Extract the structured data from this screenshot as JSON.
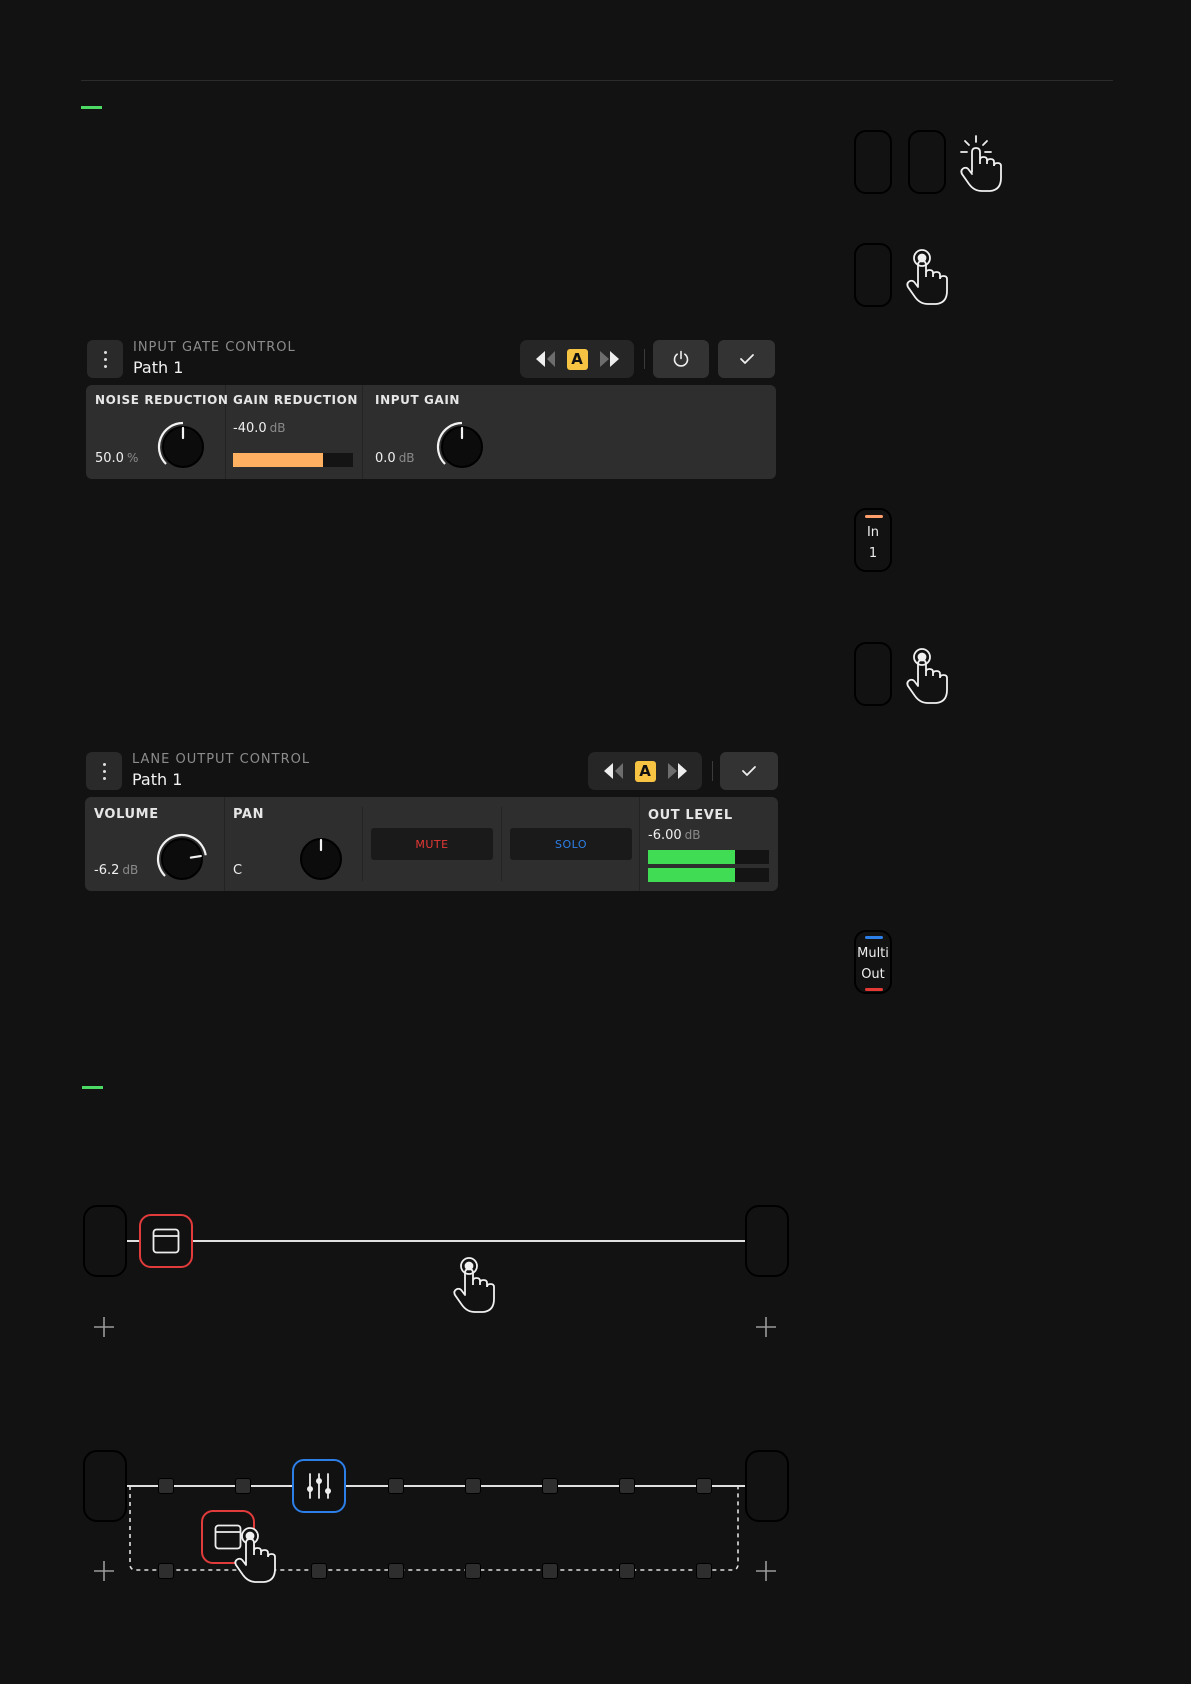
{
  "gate_panel": {
    "kicker": "INPUT GATE CONTROL",
    "path": "Path 1",
    "ab_label": "A",
    "cells": {
      "noise_reduction": {
        "label": "NOISE REDUCTION",
        "value": "50.0",
        "unit": "%",
        "knob_fraction": 0.5
      },
      "gain_reduction": {
        "label": "GAIN REDUCTION",
        "value": "-40.0",
        "unit": "dB",
        "meter_fraction": 0.75
      },
      "input_gain": {
        "label": "INPUT GAIN",
        "value": "0.0",
        "unit": "dB",
        "knob_fraction": 0.5
      }
    }
  },
  "lane_panel": {
    "kicker": "LANE OUTPUT CONTROL",
    "path": "Path 1",
    "ab_label": "A",
    "cells": {
      "volume": {
        "label": "VOLUME",
        "value": "-6.2",
        "unit": "dB",
        "knob_fraction": 0.8
      },
      "pan": {
        "label": "PAN",
        "value": "C",
        "knob_fraction": 0.5
      },
      "mute": {
        "label": "MUTE"
      },
      "solo": {
        "label": "SOLO"
      },
      "out_level": {
        "label": "OUT LEVEL",
        "value": "-6.00",
        "unit": "dB",
        "meter_fractions": [
          0.72,
          0.72
        ]
      }
    }
  },
  "nodes": {
    "in1": {
      "line1": "In",
      "line2": "1"
    },
    "multi_out": {
      "line1": "Multi",
      "line2": "Out"
    }
  },
  "colors": {
    "accent_green": "#4cd964",
    "badge_yellow": "#f6c343",
    "gain_meter": "#ffb061",
    "out_meter": "#3fdc54",
    "mute_red": "#e53935",
    "solo_blue": "#2d7fe8",
    "plugin_red": "#e23b3b",
    "plugin_blue": "#2d7fe8",
    "node_orange": "#ff9f6b"
  },
  "icons": [
    "menu-dots-icon",
    "prev-icon",
    "next-icon",
    "power-icon",
    "check-icon",
    "tap-icon",
    "touch-icon",
    "plugin-window-icon",
    "mixer-sliders-icon",
    "plus-icon"
  ]
}
